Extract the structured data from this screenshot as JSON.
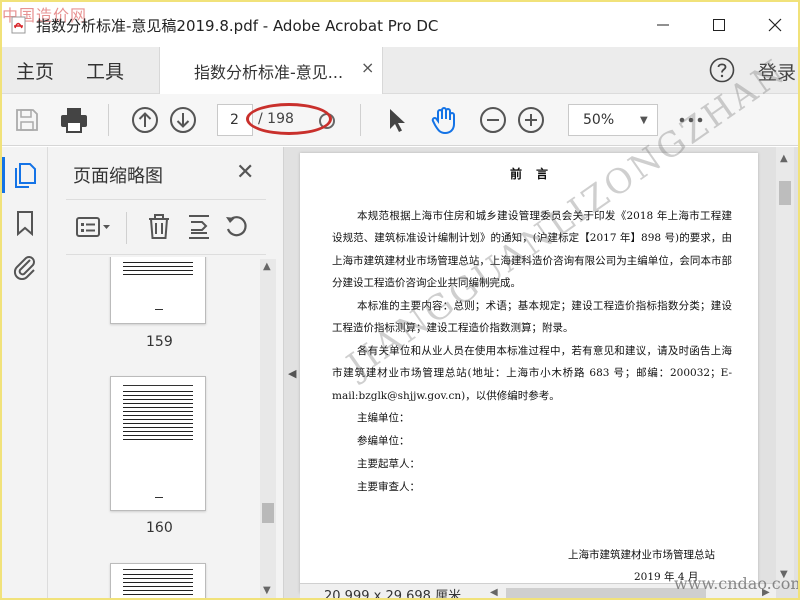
{
  "window": {
    "title": "指数分析标准-意见稿2019.8.pdf - Adobe Acrobat Pro DC",
    "watermark_left": "中国造价网",
    "watermark_site": "www.cndao.com"
  },
  "menu": {
    "home": "主页",
    "tools": "工具",
    "doc_tab": "指数分析标准-意见...",
    "doc_tab_close": "×",
    "login": "登录"
  },
  "toolbar": {
    "current_page": "2",
    "page_total": "/ 198",
    "zoom": "50%"
  },
  "thumbnails": {
    "title": "页面缩略图",
    "close": "✕",
    "pages": [
      {
        "number": "159"
      },
      {
        "number": "160"
      }
    ]
  },
  "document": {
    "heading": "前言",
    "para1": "本规范根据上海市住房和城乡建设管理委员会关于印发《2018 年上海市工程建设规范、建筑标准设计编制计划》的通知，(沪建标定【2017 年】898 号)的要求，由上海市建筑建材业市场管理总站，上海建科造价咨询有限公司为主编单位，会同本市部分建设工程造价咨询企业共同编制完成。",
    "para2": "本标准的主要内容：总则；术语；基本规定；建设工程造价指标指数分类；建设工程造价指标测算；建设工程造价指数测算；附录。",
    "para3": "各有关单位和从业人员在使用本标准过程中，若有意见和建议，请及时函告上海市建筑建材业市场管理总站(地址：上海市小木桥路 683 号；邮编：200032；E-mail:bzglk@shjjw.gov.cn)，以供修编时参考。",
    "fields": [
      "主编单位：",
      "参编单位：",
      "主要起草人：",
      "主要审查人："
    ],
    "signature_org": "上海市建筑建材业市场管理总站",
    "signature_date": "2019 年 4  月",
    "watermark": "JIANGGUANLIZONGZHAN"
  },
  "status": {
    "size": "20.999 x 29.698 厘米"
  },
  "colors": {
    "accent": "#1473e6",
    "highlight_ellipse": "#c9302c",
    "pdf_red": "#d8262b"
  }
}
